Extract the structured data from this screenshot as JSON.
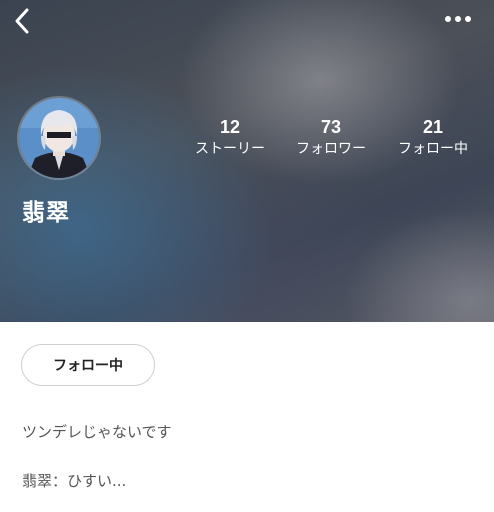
{
  "profile": {
    "username": "翡翠",
    "stats": [
      {
        "count": "12",
        "label": "ストーリー"
      },
      {
        "count": "73",
        "label": "フォロワー"
      },
      {
        "count": "21",
        "label": "フォロー中"
      }
    ],
    "follow_button_label": "フォロー中",
    "bio": [
      "ツンデレじゃないです",
      "翡翠：ひすい..."
    ]
  },
  "icons": {
    "back": "chevron-left-icon",
    "more": "more-horizontal-icon"
  },
  "colors": {
    "header_text": "#ffffff",
    "bio_text": "#555555",
    "button_border": "#d0d0d0"
  }
}
